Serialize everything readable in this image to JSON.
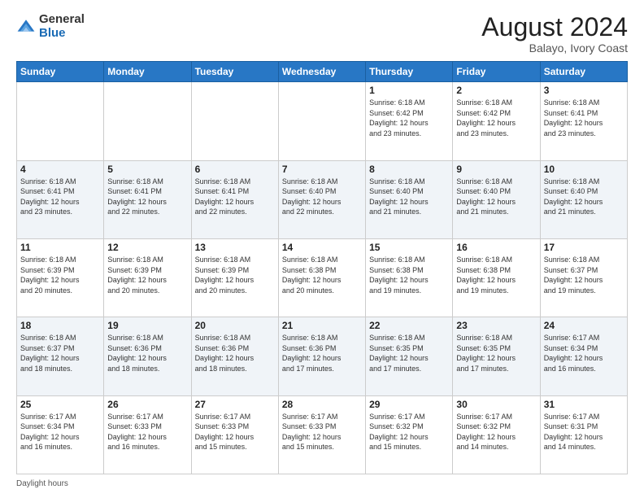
{
  "logo": {
    "general": "General",
    "blue": "Blue"
  },
  "header": {
    "title": "August 2024",
    "subtitle": "Balayo, Ivory Coast"
  },
  "weekdays": [
    "Sunday",
    "Monday",
    "Tuesday",
    "Wednesday",
    "Thursday",
    "Friday",
    "Saturday"
  ],
  "footer": {
    "daylight_label": "Daylight hours"
  },
  "weeks": [
    [
      {
        "day": "",
        "info": ""
      },
      {
        "day": "",
        "info": ""
      },
      {
        "day": "",
        "info": ""
      },
      {
        "day": "",
        "info": ""
      },
      {
        "day": "1",
        "info": "Sunrise: 6:18 AM\nSunset: 6:42 PM\nDaylight: 12 hours\nand 23 minutes."
      },
      {
        "day": "2",
        "info": "Sunrise: 6:18 AM\nSunset: 6:42 PM\nDaylight: 12 hours\nand 23 minutes."
      },
      {
        "day": "3",
        "info": "Sunrise: 6:18 AM\nSunset: 6:41 PM\nDaylight: 12 hours\nand 23 minutes."
      }
    ],
    [
      {
        "day": "4",
        "info": "Sunrise: 6:18 AM\nSunset: 6:41 PM\nDaylight: 12 hours\nand 23 minutes."
      },
      {
        "day": "5",
        "info": "Sunrise: 6:18 AM\nSunset: 6:41 PM\nDaylight: 12 hours\nand 22 minutes."
      },
      {
        "day": "6",
        "info": "Sunrise: 6:18 AM\nSunset: 6:41 PM\nDaylight: 12 hours\nand 22 minutes."
      },
      {
        "day": "7",
        "info": "Sunrise: 6:18 AM\nSunset: 6:40 PM\nDaylight: 12 hours\nand 22 minutes."
      },
      {
        "day": "8",
        "info": "Sunrise: 6:18 AM\nSunset: 6:40 PM\nDaylight: 12 hours\nand 21 minutes."
      },
      {
        "day": "9",
        "info": "Sunrise: 6:18 AM\nSunset: 6:40 PM\nDaylight: 12 hours\nand 21 minutes."
      },
      {
        "day": "10",
        "info": "Sunrise: 6:18 AM\nSunset: 6:40 PM\nDaylight: 12 hours\nand 21 minutes."
      }
    ],
    [
      {
        "day": "11",
        "info": "Sunrise: 6:18 AM\nSunset: 6:39 PM\nDaylight: 12 hours\nand 20 minutes."
      },
      {
        "day": "12",
        "info": "Sunrise: 6:18 AM\nSunset: 6:39 PM\nDaylight: 12 hours\nand 20 minutes."
      },
      {
        "day": "13",
        "info": "Sunrise: 6:18 AM\nSunset: 6:39 PM\nDaylight: 12 hours\nand 20 minutes."
      },
      {
        "day": "14",
        "info": "Sunrise: 6:18 AM\nSunset: 6:38 PM\nDaylight: 12 hours\nand 20 minutes."
      },
      {
        "day": "15",
        "info": "Sunrise: 6:18 AM\nSunset: 6:38 PM\nDaylight: 12 hours\nand 19 minutes."
      },
      {
        "day": "16",
        "info": "Sunrise: 6:18 AM\nSunset: 6:38 PM\nDaylight: 12 hours\nand 19 minutes."
      },
      {
        "day": "17",
        "info": "Sunrise: 6:18 AM\nSunset: 6:37 PM\nDaylight: 12 hours\nand 19 minutes."
      }
    ],
    [
      {
        "day": "18",
        "info": "Sunrise: 6:18 AM\nSunset: 6:37 PM\nDaylight: 12 hours\nand 18 minutes."
      },
      {
        "day": "19",
        "info": "Sunrise: 6:18 AM\nSunset: 6:36 PM\nDaylight: 12 hours\nand 18 minutes."
      },
      {
        "day": "20",
        "info": "Sunrise: 6:18 AM\nSunset: 6:36 PM\nDaylight: 12 hours\nand 18 minutes."
      },
      {
        "day": "21",
        "info": "Sunrise: 6:18 AM\nSunset: 6:36 PM\nDaylight: 12 hours\nand 17 minutes."
      },
      {
        "day": "22",
        "info": "Sunrise: 6:18 AM\nSunset: 6:35 PM\nDaylight: 12 hours\nand 17 minutes."
      },
      {
        "day": "23",
        "info": "Sunrise: 6:18 AM\nSunset: 6:35 PM\nDaylight: 12 hours\nand 17 minutes."
      },
      {
        "day": "24",
        "info": "Sunrise: 6:17 AM\nSunset: 6:34 PM\nDaylight: 12 hours\nand 16 minutes."
      }
    ],
    [
      {
        "day": "25",
        "info": "Sunrise: 6:17 AM\nSunset: 6:34 PM\nDaylight: 12 hours\nand 16 minutes."
      },
      {
        "day": "26",
        "info": "Sunrise: 6:17 AM\nSunset: 6:33 PM\nDaylight: 12 hours\nand 16 minutes."
      },
      {
        "day": "27",
        "info": "Sunrise: 6:17 AM\nSunset: 6:33 PM\nDaylight: 12 hours\nand 15 minutes."
      },
      {
        "day": "28",
        "info": "Sunrise: 6:17 AM\nSunset: 6:33 PM\nDaylight: 12 hours\nand 15 minutes."
      },
      {
        "day": "29",
        "info": "Sunrise: 6:17 AM\nSunset: 6:32 PM\nDaylight: 12 hours\nand 15 minutes."
      },
      {
        "day": "30",
        "info": "Sunrise: 6:17 AM\nSunset: 6:32 PM\nDaylight: 12 hours\nand 14 minutes."
      },
      {
        "day": "31",
        "info": "Sunrise: 6:17 AM\nSunset: 6:31 PM\nDaylight: 12 hours\nand 14 minutes."
      }
    ]
  ]
}
